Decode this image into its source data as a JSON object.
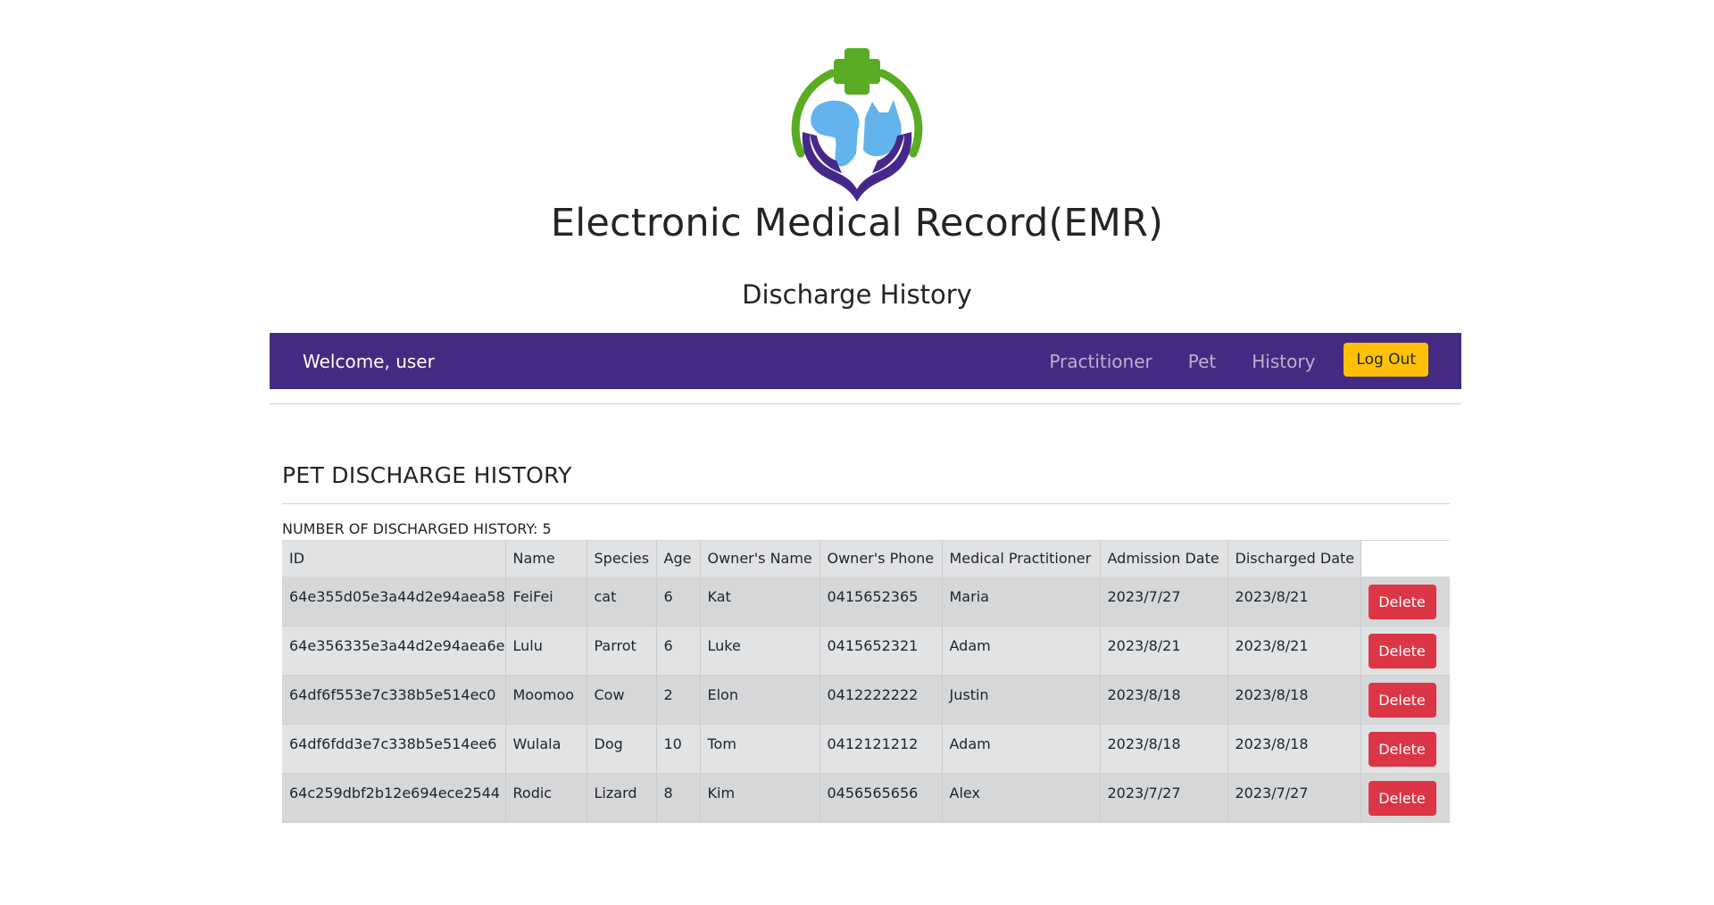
{
  "header": {
    "logo_icon": "veterinary-care-logo-icon",
    "app_title": "Electronic Medical Record(EMR)",
    "page_subtitle": "Discharge History"
  },
  "navbar": {
    "welcome_text": "Welcome, user",
    "links": [
      "Practitioner",
      "Pet",
      "History"
    ],
    "logout_label": "Log Out",
    "background_color": "#452a83",
    "logout_color": "#ffc107"
  },
  "main": {
    "section_title": "PET DISCHARGE HISTORY",
    "record_count_text": "NUMBER OF DISCHARGED HISTORY: 5",
    "table": {
      "columns": [
        "ID",
        "Name",
        "Species",
        "Age",
        "Owner's Name",
        "Owner's Phone",
        "Medical Practitioner",
        "Admission Date",
        "Discharged Date"
      ],
      "delete_label": "Delete",
      "delete_color": "#dc3545",
      "rows": [
        [
          "64e355d05e3a44d2e94aea58",
          "FeiFei",
          "cat",
          "6",
          "Kat",
          "0415652365",
          "Maria",
          "2023/7/27",
          "2023/8/21"
        ],
        [
          "64e356335e3a44d2e94aea6e",
          "Lulu",
          "Parrot",
          "6",
          "Luke",
          "0415652321",
          "Adam",
          "2023/8/21",
          "2023/8/21"
        ],
        [
          "64df6f553e7c338b5e514ec0",
          "Moomoo",
          "Cow",
          "2",
          "Elon",
          "0412222222",
          "Justin",
          "2023/8/18",
          "2023/8/18"
        ],
        [
          "64df6fdd3e7c338b5e514ee6",
          "Wulala",
          "Dog",
          "10",
          "Tom",
          "0412121212",
          "Adam",
          "2023/8/18",
          "2023/8/18"
        ],
        [
          "64c259dbf2b12e694ece2544",
          "Rodic",
          "Lizard",
          "8",
          "Kim",
          "0456565656",
          "Alex",
          "2023/7/27",
          "2023/7/27"
        ]
      ]
    }
  }
}
